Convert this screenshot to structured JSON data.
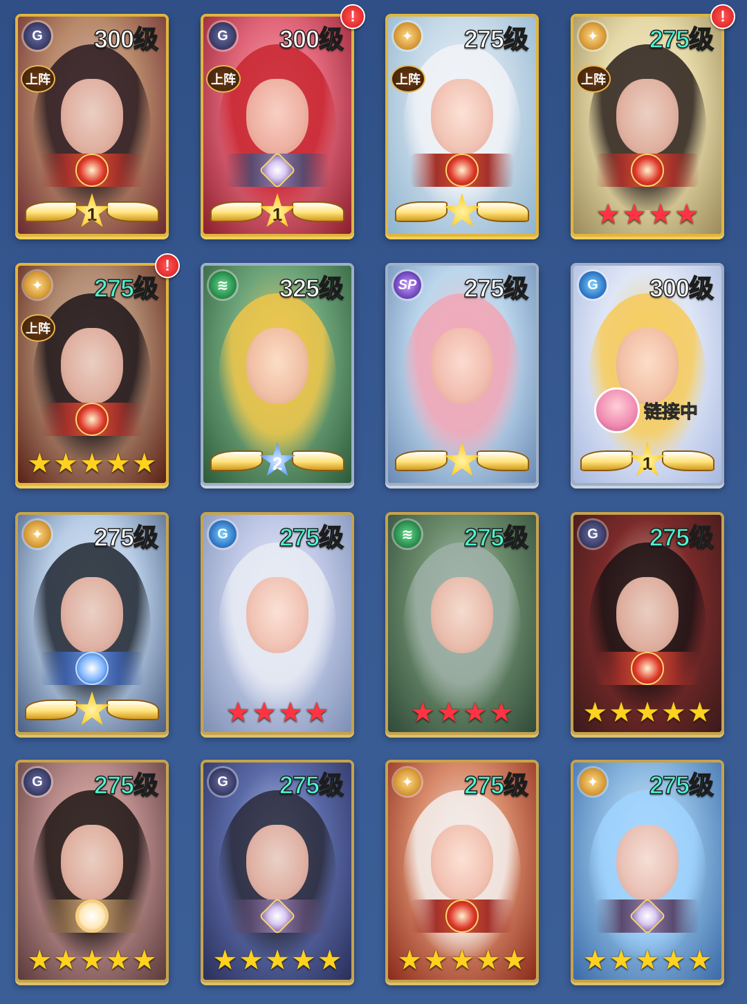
{
  "deploy_label": "上阵",
  "link_label": "链接中",
  "alert_symbol": "!",
  "cards": [
    {
      "level": "300级",
      "level_color": "white",
      "faction": "dark",
      "deployed": true,
      "emblem": "red",
      "rank": "wings",
      "badge": "1",
      "alert": false
    },
    {
      "level": "300级",
      "level_color": "white",
      "faction": "dark",
      "deployed": true,
      "emblem": "purple",
      "rank": "wings",
      "badge": "1",
      "alert": true
    },
    {
      "level": "275级",
      "level_color": "white",
      "faction": "light",
      "deployed": true,
      "emblem": "red",
      "rank": "wings",
      "badge": "★",
      "alert": false
    },
    {
      "level": "275级",
      "level_color": "cyan",
      "faction": "light",
      "deployed": true,
      "emblem": "red",
      "rank": "red-stars",
      "stars": 4,
      "alert": true
    },
    {
      "level": "275级",
      "level_color": "cyan",
      "faction": "light",
      "deployed": true,
      "emblem": "red",
      "rank": "gold-stars",
      "stars": 5,
      "alert": true
    },
    {
      "level": "325级",
      "level_color": "white",
      "faction": "nature",
      "deployed": false,
      "emblem": "none",
      "rank": "wings-blue",
      "badge": "2",
      "alert": false
    },
    {
      "level": "275级",
      "level_color": "white",
      "faction": "sp",
      "deployed": false,
      "emblem": "none",
      "rank": "wings",
      "badge": "★",
      "alert": false
    },
    {
      "level": "300级",
      "level_color": "white",
      "faction": "water",
      "deployed": false,
      "emblem": "none",
      "rank": "wings",
      "badge": "1",
      "alert": false,
      "linked": true
    },
    {
      "level": "275级",
      "level_color": "white",
      "faction": "light",
      "deployed": false,
      "emblem": "blue",
      "rank": "wings",
      "badge": "★",
      "alert": false
    },
    {
      "level": "275级",
      "level_color": "cyan",
      "faction": "water",
      "deployed": false,
      "emblem": "none",
      "rank": "red-stars",
      "stars": 4,
      "alert": false
    },
    {
      "level": "275级",
      "level_color": "cyan",
      "faction": "nature",
      "deployed": false,
      "emblem": "none",
      "rank": "red-stars",
      "stars": 4,
      "alert": false
    },
    {
      "level": "275级",
      "level_color": "cyan",
      "faction": "dark",
      "deployed": false,
      "emblem": "red",
      "rank": "gold-stars",
      "stars": 5,
      "alert": false
    },
    {
      "level": "275级",
      "level_color": "cyan",
      "faction": "dark",
      "deployed": false,
      "emblem": "cream",
      "rank": "gold-stars",
      "stars": 5,
      "alert": false
    },
    {
      "level": "275级",
      "level_color": "cyan",
      "faction": "dark",
      "deployed": false,
      "emblem": "purple",
      "rank": "gold-stars",
      "stars": 5,
      "alert": false
    },
    {
      "level": "275级",
      "level_color": "cyan",
      "faction": "light",
      "deployed": false,
      "emblem": "red",
      "rank": "gold-stars",
      "stars": 5,
      "alert": false
    },
    {
      "level": "275级",
      "level_color": "cyan",
      "faction": "light",
      "deployed": false,
      "emblem": "purple",
      "rank": "gold-stars",
      "stars": 5,
      "alert": false
    }
  ],
  "faction_icons": {
    "dark": "G",
    "light": "✦",
    "nature": "≋",
    "water": "G",
    "sp": "SP"
  },
  "colors": {
    "background": "#385a93",
    "level_white": "#ffffff",
    "level_cyan": "#4ef3d0",
    "star_gold": "#ffd21f",
    "star_red": "#ff3344",
    "alert_red": "#d51616"
  }
}
